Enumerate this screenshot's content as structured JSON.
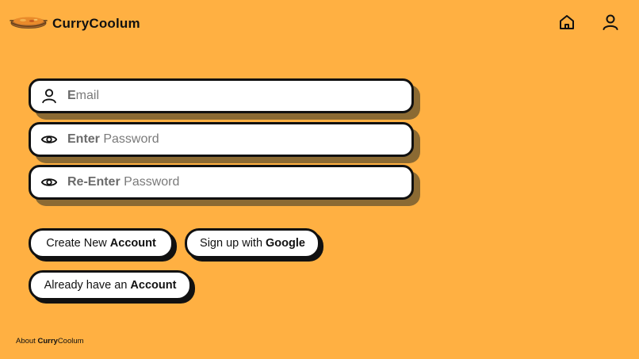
{
  "header": {
    "brand_part1": "Curry",
    "brand_part2": "Coolum",
    "home_icon": "home-icon",
    "user_icon": "user-icon",
    "logo_icon": "curry-bowl-icon"
  },
  "form": {
    "email": {
      "icon": "user-icon",
      "placeholder_strong": "E",
      "placeholder_rest": "mail"
    },
    "password": {
      "icon": "eye-icon",
      "placeholder_strong": "Enter",
      "placeholder_rest": "Password"
    },
    "repassword": {
      "icon": "eye-icon",
      "placeholder_strong": "Re-Enter",
      "placeholder_rest": "Password"
    }
  },
  "buttons": {
    "create": {
      "label_regular": "Create New",
      "label_strong": "Account"
    },
    "google": {
      "label_regular": "Sign up with",
      "label_strong": "Google"
    },
    "already": {
      "label_regular": "Already have an",
      "label_strong": "Account"
    }
  },
  "footer": {
    "prefix": "About",
    "brand_strong": "Curry",
    "brand_rest": "Coolum"
  },
  "colors": {
    "background": "#FFB042",
    "field_shadow": "#8B6A33",
    "border": "#111111",
    "surface": "#FFFFFF"
  }
}
